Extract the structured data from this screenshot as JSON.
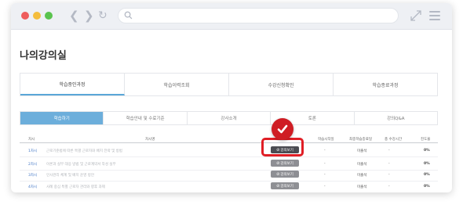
{
  "page": {
    "title": "나의강의실"
  },
  "main_tabs": [
    {
      "label": "학습중인과정",
      "active": true
    },
    {
      "label": "학습이력조회",
      "active": false
    },
    {
      "label": "수강신청확인",
      "active": false
    },
    {
      "label": "학습종료과정",
      "active": false
    }
  ],
  "sub_tabs": [
    {
      "label": "학습하기",
      "active": true
    },
    {
      "label": "학습안내 및 수료기준",
      "active": false
    },
    {
      "label": "강사소개",
      "active": false
    },
    {
      "label": "토론",
      "active": false
    },
    {
      "label": "강의Q&A",
      "active": false
    }
  ],
  "table": {
    "headers": {
      "order": "차시",
      "title": "차시명",
      "start_date": "학습시작일",
      "last_study_date": "최종학습종료일",
      "total_study": "총 수강시간",
      "progress": "진도율"
    },
    "rows": [
      {
        "order": "1차시",
        "title": "근로기준법에 따른 특별 근로자와 배치 전략 및 방법",
        "button": "강의보기",
        "highlighted": true,
        "dash1": "-",
        "status": "미출석",
        "dash2": "-",
        "progress": "0%"
      },
      {
        "order": "2차시",
        "title": "이론과 실무 대응 방법 및 근로계약서 작성 실무",
        "button": "강의보기",
        "highlighted": false,
        "dash1": "-",
        "status": "미출석",
        "dash2": "-",
        "progress": "0%"
      },
      {
        "order": "3차시",
        "title": "인사관리 체계 및 배치 운영 방안",
        "button": "강의보기",
        "highlighted": false,
        "dash1": "-",
        "status": "미출석",
        "dash2": "-",
        "progress": "0%"
      },
      {
        "order": "4차시",
        "title": "사례 중심 특별 근로자 관리와 향후 과제",
        "button": "강의보기",
        "highlighted": false,
        "dash1": "-",
        "status": "미출석",
        "dash2": "-",
        "progress": "0%"
      }
    ]
  },
  "colors": {
    "accent_blue": "#6caedb",
    "highlight_red": "#e01e25",
    "link_blue": "#3f74c5"
  },
  "icons": {
    "window_controls": [
      "close-dot",
      "minimize-dot",
      "maximize-dot"
    ],
    "nav": [
      "back-icon",
      "forward-icon",
      "reload-icon"
    ],
    "right": [
      "expand-icon",
      "menu-icon"
    ],
    "highlight": "checkmark-icon"
  }
}
